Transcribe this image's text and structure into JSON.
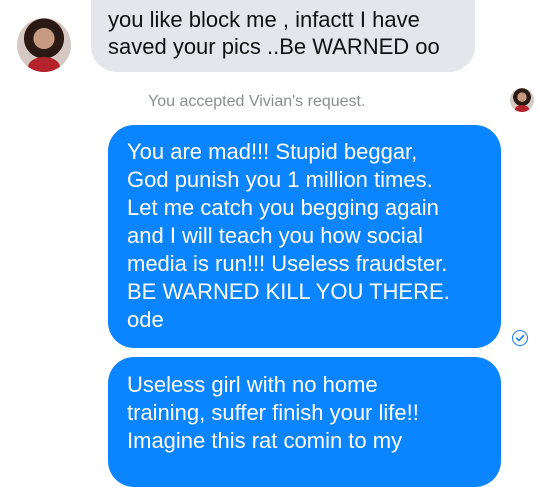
{
  "conversation": {
    "incoming": {
      "lines": [
        "you like block me , infactt I have",
        "saved your pics ..Be WARNED oo"
      ]
    },
    "system_message": "You accepted Vivian's request.",
    "outgoing": [
      {
        "lines": [
          "You are mad!!! Stupid beggar,",
          "God punish you 1 million times.",
          "Let me catch you begging again",
          "and I will teach you how social",
          "media is run!!! Useless fraudster.",
          "BE WARNED KILL YOU THERE.",
          "ode"
        ]
      },
      {
        "lines": [
          "Useless girl with no home",
          "training, suffer finish your life!!",
          "Imagine this rat comin to my"
        ]
      }
    ]
  },
  "colors": {
    "outgoing_bubble": "#0b84ff",
    "incoming_bubble": "#e4e6eb",
    "system_text": "#8a8d91",
    "seen_indicator": "#1877f2"
  },
  "icons": [
    "contact-avatar",
    "read-receipt-avatar",
    "seen-check-icon"
  ]
}
